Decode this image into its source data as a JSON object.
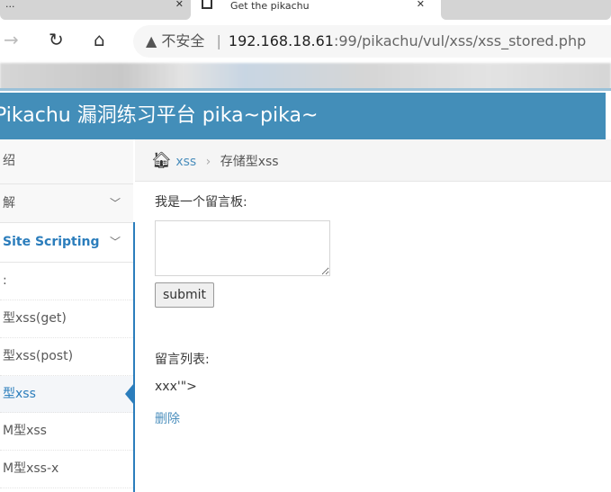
{
  "browser": {
    "tabs": [
      {
        "label": "..."
      },
      {
        "label": "Get the pikachu"
      }
    ],
    "security_label": "不安全",
    "url_host": "192.168.18.61",
    "url_path": ":99/pikachu/vul/xss/xss_stored.php"
  },
  "header": {
    "title": "Pikachu 漏洞练习平台 pika~pika~"
  },
  "sidebar": {
    "items": [
      {
        "label": "绍"
      },
      {
        "label": "解"
      },
      {
        "label": "Site Scripting"
      },
      {
        "label": ":"
      },
      {
        "label": "型xss(get)"
      },
      {
        "label": "型xss(post)"
      },
      {
        "label": "型xss"
      },
      {
        "label": "M型xss"
      },
      {
        "label": "M型xss-x"
      }
    ]
  },
  "breadcrumb": {
    "parent": "xss",
    "current": "存储型xss"
  },
  "main": {
    "board_label": "我是一个留言板:",
    "message_value": "",
    "submit_label": "submit",
    "list_label": "留言列表:",
    "messages": [
      {
        "text": "xxx'\">",
        "delete_label": "删除"
      }
    ]
  },
  "colors": {
    "header": "#438eb9",
    "accent": "#2b7dbc",
    "link": "#4c8fbd"
  }
}
